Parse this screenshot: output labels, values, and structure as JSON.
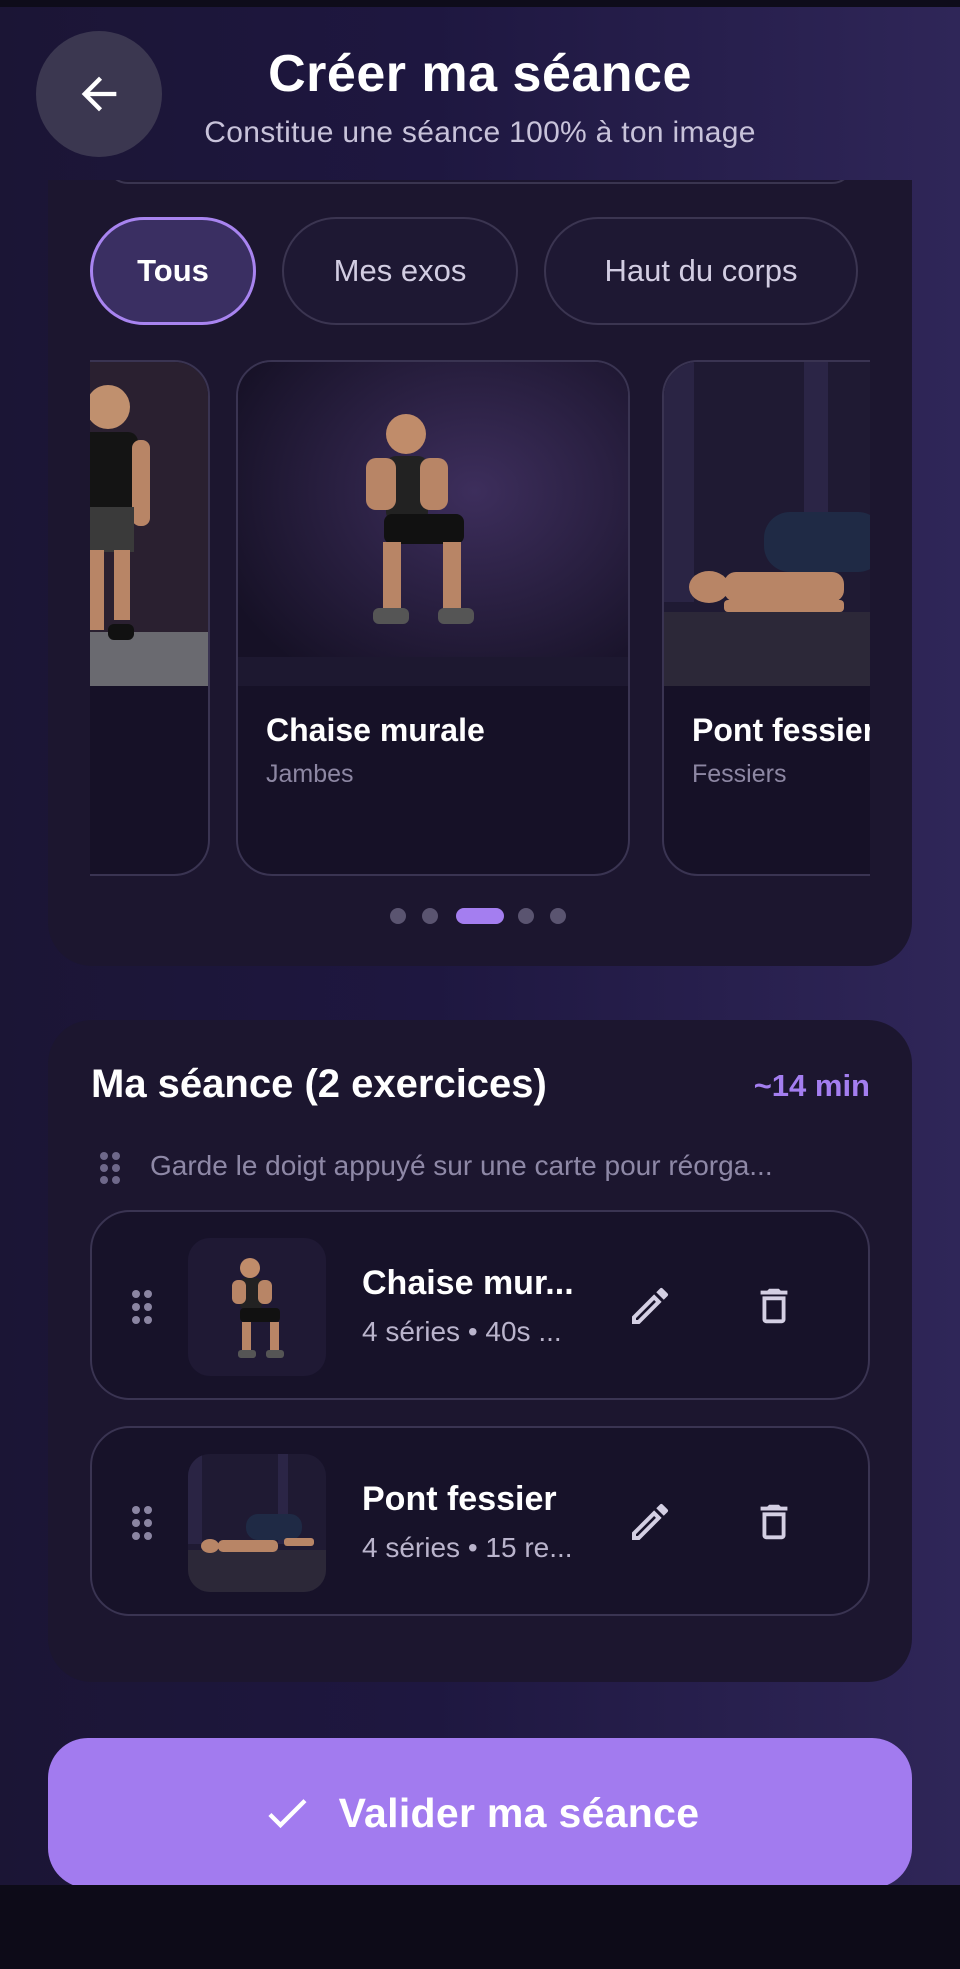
{
  "header": {
    "title": "Créer ma séance",
    "subtitle": "Constitue une séance 100% à ton image",
    "back_icon": "arrow-left-icon"
  },
  "filters": {
    "chips": [
      {
        "label": "Tous",
        "active": true
      },
      {
        "label": "Mes exos",
        "active": false
      },
      {
        "label": "Haut du corps",
        "active": false
      }
    ]
  },
  "carousel": {
    "cards": [
      {
        "name": "",
        "category": ""
      },
      {
        "name": "Chaise murale",
        "category": "Jambes"
      },
      {
        "name": "Pont fessier",
        "category": "Fessiers"
      }
    ],
    "page_count": 5,
    "active_page": 3
  },
  "session": {
    "title": "Ma séance (2 exercices)",
    "duration": "~14 min",
    "hint": "Garde le doigt appuyé sur une carte pour réorga...",
    "items": [
      {
        "name": "Chaise mur...",
        "detail": "4 séries • 40s ..."
      },
      {
        "name": "Pont fessier",
        "detail": "4 séries • 15 re..."
      }
    ]
  },
  "actions": {
    "validate_label": "Valider ma séance",
    "validate_icon": "check-icon"
  },
  "colors": {
    "accent": "#a47ef0",
    "card": "#1c162f",
    "background": "#1e1740"
  }
}
